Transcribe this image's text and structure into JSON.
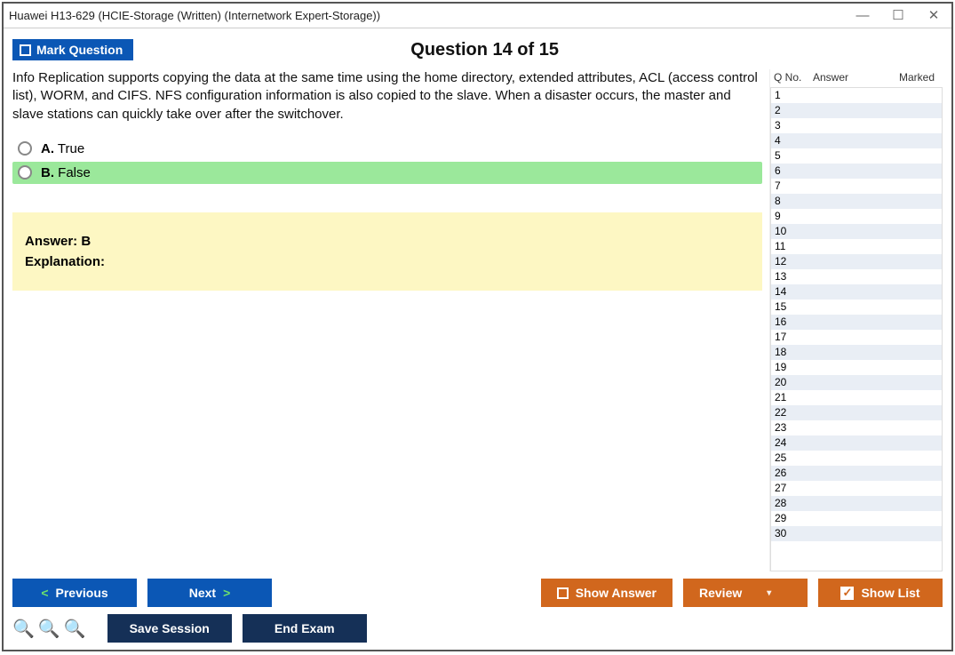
{
  "window": {
    "title": "Huawei H13-629 (HCIE-Storage (Written) (Internetwork Expert-Storage))"
  },
  "header": {
    "mark_label": "Mark Question",
    "question_title": "Question 14 of 15"
  },
  "question": {
    "text": "Info Replication supports copying the data at the same time using the home directory, extended attributes, ACL (access control list), WORM, and CIFS. NFS configuration information is also copied to the slave. When a disaster occurs, the master and slave stations can quickly take over after the switchover.",
    "options": [
      {
        "letter": "A.",
        "label": "True",
        "correct": false
      },
      {
        "letter": "B.",
        "label": "False",
        "correct": true
      }
    ],
    "answer_label": "Answer: B",
    "explanation_label": "Explanation:"
  },
  "sidebar": {
    "headers": {
      "qno": "Q No.",
      "answer": "Answer",
      "marked": "Marked"
    },
    "rows": [
      "1",
      "2",
      "3",
      "4",
      "5",
      "6",
      "7",
      "8",
      "9",
      "10",
      "11",
      "12",
      "13",
      "14",
      "15",
      "16",
      "17",
      "18",
      "19",
      "20",
      "21",
      "22",
      "23",
      "24",
      "25",
      "26",
      "27",
      "28",
      "29",
      "30"
    ]
  },
  "footer": {
    "previous": "Previous",
    "next": "Next",
    "show_answer": "Show Answer",
    "review": "Review",
    "show_list": "Show List",
    "save_session": "Save Session",
    "end_exam": "End Exam"
  }
}
